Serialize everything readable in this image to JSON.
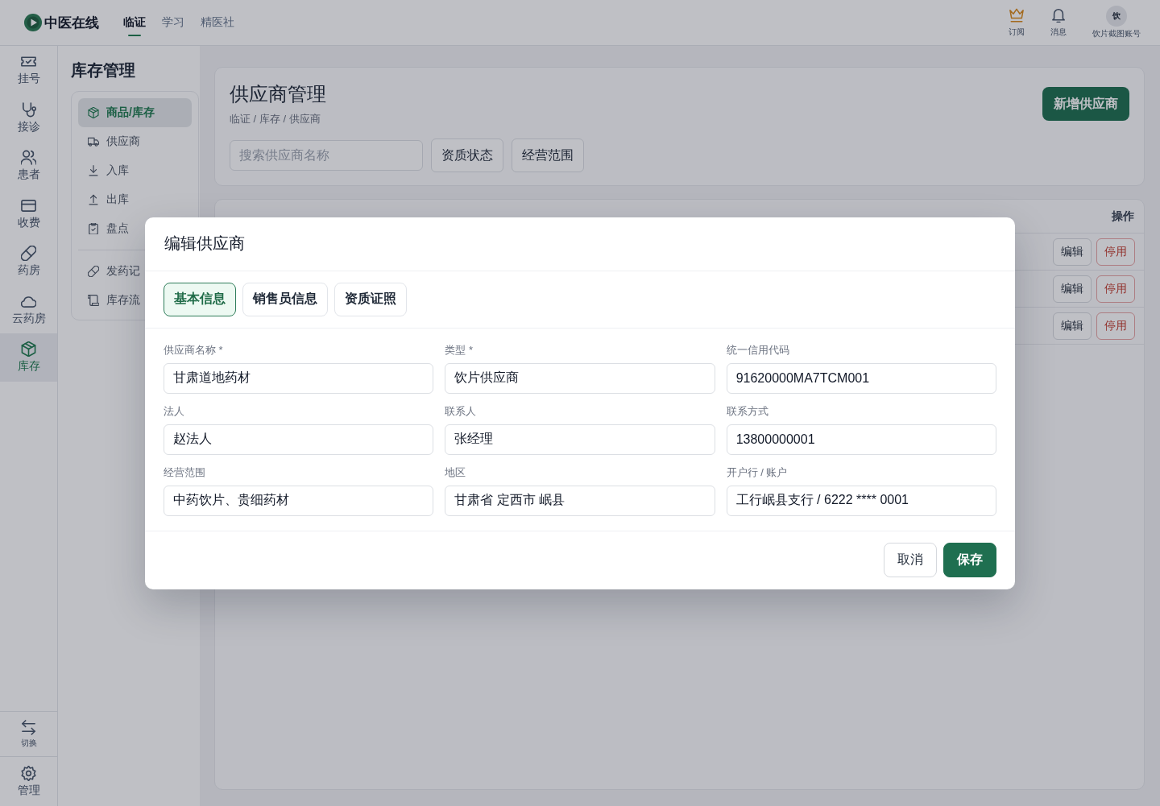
{
  "topbar": {
    "logo": "中医在线",
    "nav": [
      {
        "label": "临证",
        "selected": true
      },
      {
        "label": "学习",
        "selected": false
      },
      {
        "label": "精医社",
        "selected": false
      }
    ],
    "actions": [
      {
        "label": "订阅"
      },
      {
        "label": "消息"
      }
    ],
    "account": {
      "avatar": "饮",
      "name": "饮片截图账号"
    }
  },
  "rail": {
    "items": [
      {
        "label": "挂号",
        "selected": false
      },
      {
        "label": "接诊",
        "selected": false
      },
      {
        "label": "患者",
        "selected": false
      },
      {
        "label": "收费",
        "selected": false
      },
      {
        "label": "药房",
        "selected": false
      },
      {
        "label": "云药房",
        "selected": false
      },
      {
        "label": "库存",
        "selected": true
      }
    ],
    "bottom": [
      {
        "label": "切换"
      },
      {
        "label": "管理"
      }
    ]
  },
  "inventory_menu": {
    "title": "库存管理",
    "groups": [
      {
        "items": [
          {
            "label": "商品/库存",
            "selected": true
          },
          {
            "label": "供应商",
            "selected": false
          },
          {
            "label": "入库",
            "selected": false
          },
          {
            "label": "出库",
            "selected": false
          },
          {
            "label": "盘点",
            "selected": false
          }
        ]
      },
      {
        "items": [
          {
            "label": "发药记",
            "selected": false
          },
          {
            "label": "库存流",
            "selected": false
          }
        ]
      }
    ]
  },
  "page": {
    "title": "供应商管理",
    "breadcrumb": "临证 / 库存 / 供应商",
    "search": {
      "placeholder": "搜索供应商名称"
    },
    "filters": [
      "资质状态",
      "经营范围"
    ],
    "add_button": "新增供应商"
  },
  "table": {
    "action_header": "操作",
    "rows": [
      {
        "actions": [
          {
            "kind": "edit",
            "label": "编辑"
          },
          {
            "kind": "disable",
            "label": "停用"
          }
        ]
      },
      {
        "actions": [
          {
            "kind": "edit",
            "label": "编辑"
          },
          {
            "kind": "disable",
            "label": "停用"
          }
        ]
      },
      {
        "actions": [
          {
            "kind": "edit",
            "label": "编辑"
          },
          {
            "kind": "disable",
            "label": "停用"
          }
        ]
      }
    ]
  },
  "dialog": {
    "title": "编辑供应商",
    "tabs": [
      {
        "label": "基本信息",
        "selected": true
      },
      {
        "label": "销售员信息",
        "selected": false
      },
      {
        "label": "资质证照",
        "selected": false
      }
    ],
    "fields": [
      {
        "label": "供应商名称 *",
        "value": "甘肃道地药材"
      },
      {
        "label": "类型 *",
        "value": "饮片供应商"
      },
      {
        "label": "统一信用代码",
        "value": "91620000MA7TCM001"
      },
      {
        "label": "法人",
        "value": "赵法人"
      },
      {
        "label": "联系人",
        "value": "张经理"
      },
      {
        "label": "联系方式",
        "value": "13800000001"
      },
      {
        "label": "经营范围",
        "value": "中药饮片、贵细药材"
      },
      {
        "label": "地区",
        "value": "甘肃省 定西市 岷县"
      },
      {
        "label": "开户行 / 账户",
        "value": "工行岷县支行 / 6222 **** 0001"
      }
    ],
    "buttons": [
      {
        "kind": "secondary",
        "label": "取消"
      },
      {
        "kind": "primary",
        "label": "保存"
      }
    ]
  }
}
